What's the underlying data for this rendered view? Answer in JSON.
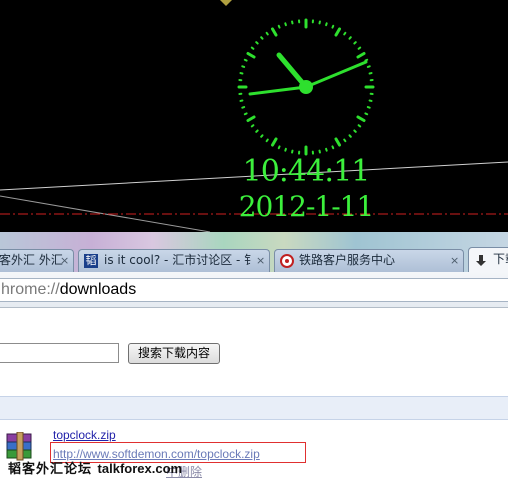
{
  "clock": {
    "time": "10:44:11",
    "date": "2012-1-11"
  },
  "tabs": [
    {
      "title": "客外汇 外汇",
      "close": "×",
      "icon": "none"
    },
    {
      "title": "is it cool? - 汇市讨论区 - 钅",
      "close": "×",
      "icon": "forum-favicon-icon"
    },
    {
      "title": "铁路客户服务中心",
      "close": "×",
      "icon": "railway-favicon-icon"
    },
    {
      "title": "下载",
      "close": "",
      "icon": "download-arrow-icon"
    }
  ],
  "address_bar": {
    "scheme": "hrome://",
    "path": "downloads"
  },
  "downloads": {
    "search_placeholder": "",
    "search_button": "搜索下载内容",
    "item": {
      "file_name": "topclock.zip",
      "url": "http://www.softdemon.com/topclock.zip",
      "remove_label": "中删除",
      "icon": "winrar-archive-icon"
    }
  },
  "watermark": {
    "chinese": "韬客外汇论坛",
    "site": "talkforex.com"
  },
  "colors": {
    "clock_green": "#3cf03c",
    "link_blue": "#2222aa",
    "highlight_red": "#e03030"
  }
}
